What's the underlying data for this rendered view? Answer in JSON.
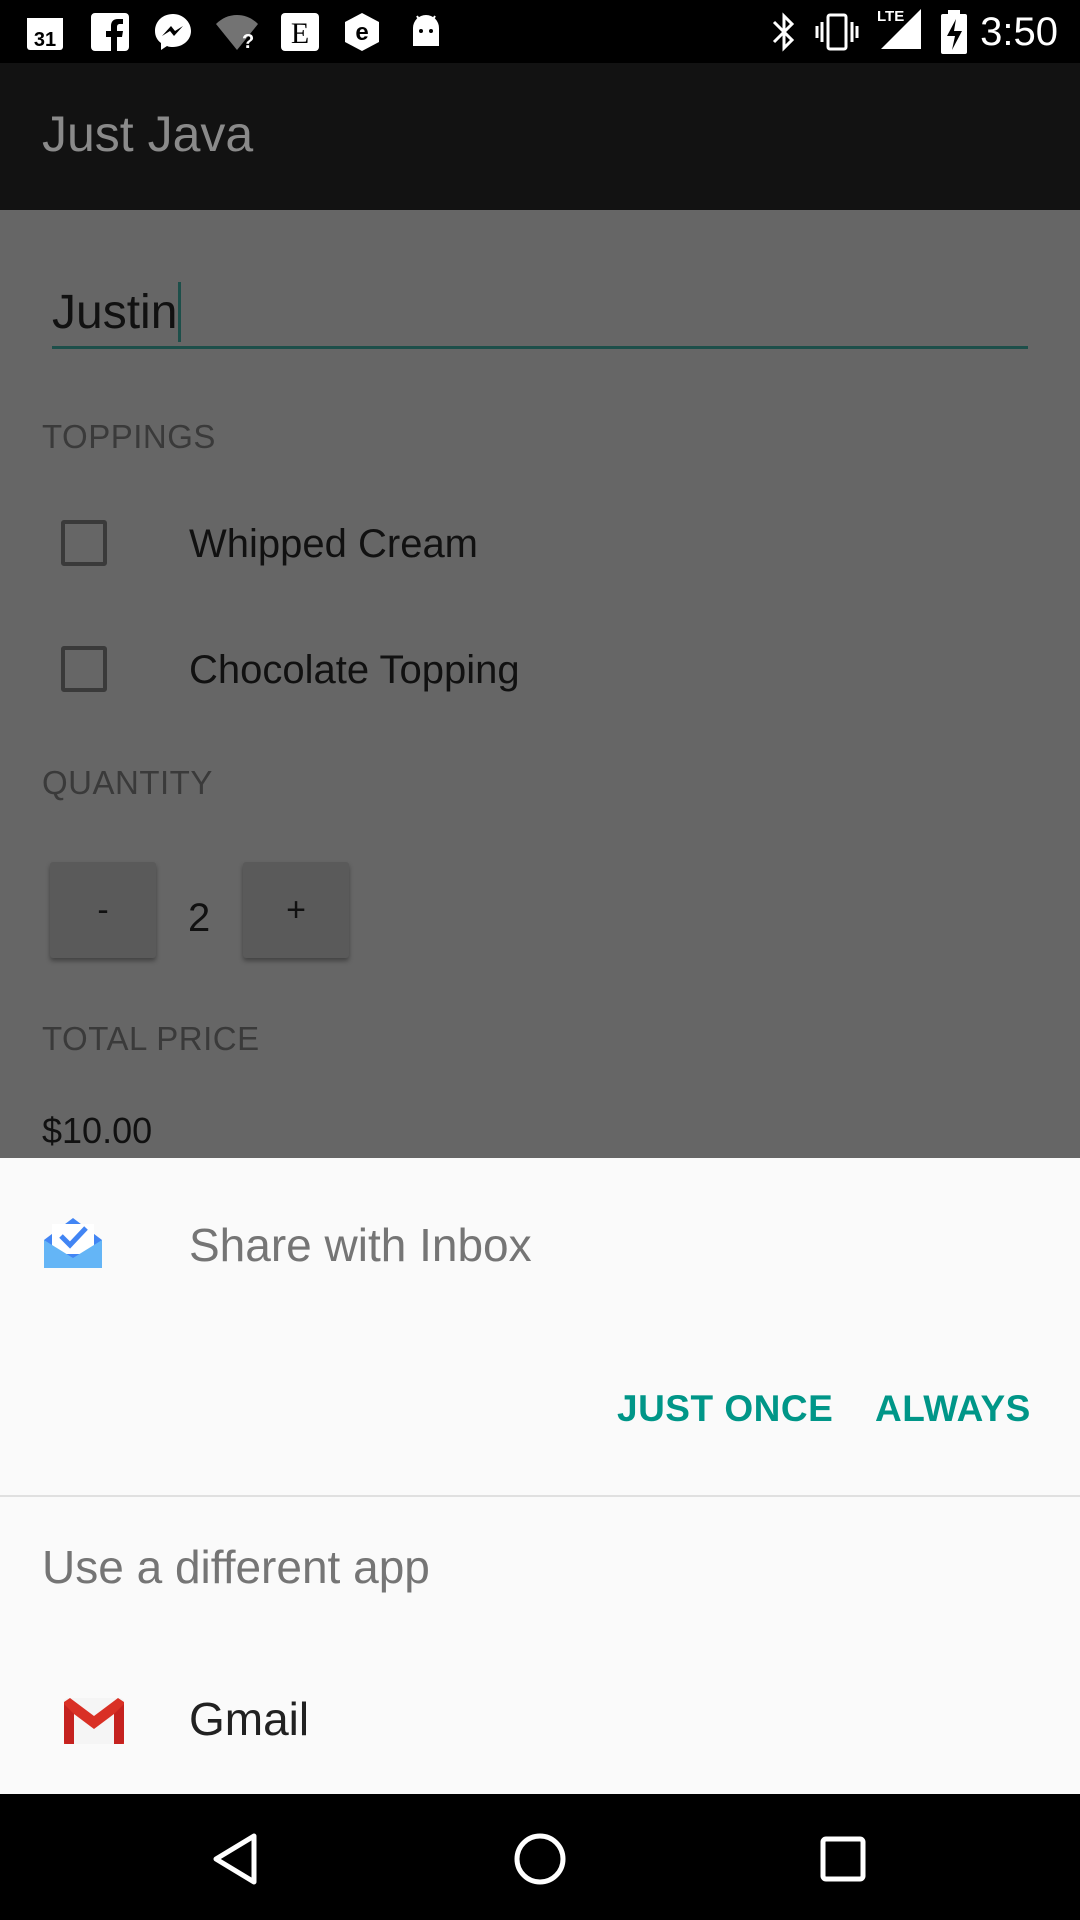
{
  "status_bar": {
    "time": "3:50",
    "calendar_day": "31",
    "network_label": "LTE",
    "left_icons": [
      "calendar-icon",
      "facebook-icon",
      "messenger-icon",
      "wifi-unknown-icon",
      "etsy-icon",
      "edge-e-icon",
      "android-icon"
    ],
    "right_icons": [
      "bluetooth-icon",
      "vibrate-icon",
      "signal-icon",
      "battery-charging-icon"
    ]
  },
  "app_bar": {
    "title": "Just Java"
  },
  "form": {
    "name_value": "Justin",
    "toppings_label": "TOPPINGS",
    "toppings": [
      {
        "label": "Whipped Cream",
        "checked": false
      },
      {
        "label": "Chocolate Topping",
        "checked": false
      }
    ],
    "quantity_label": "QUANTITY",
    "decrement_label": "-",
    "increment_label": "+",
    "quantity": "2",
    "total_price_label": "TOTAL PRICE",
    "total_price": "$10.00"
  },
  "chooser": {
    "share_title": "Share with Inbox",
    "just_once": "JUST ONCE",
    "always": "ALWAYS",
    "different_app": "Use a different app",
    "apps": [
      {
        "label": "Gmail",
        "icon": "gmail-icon"
      }
    ]
  },
  "nav_bar": {
    "icons": [
      "back-icon",
      "home-icon",
      "recents-icon"
    ]
  },
  "colors": {
    "accent": "#009688",
    "overlay": "#666666",
    "app_bar": "#121212"
  }
}
